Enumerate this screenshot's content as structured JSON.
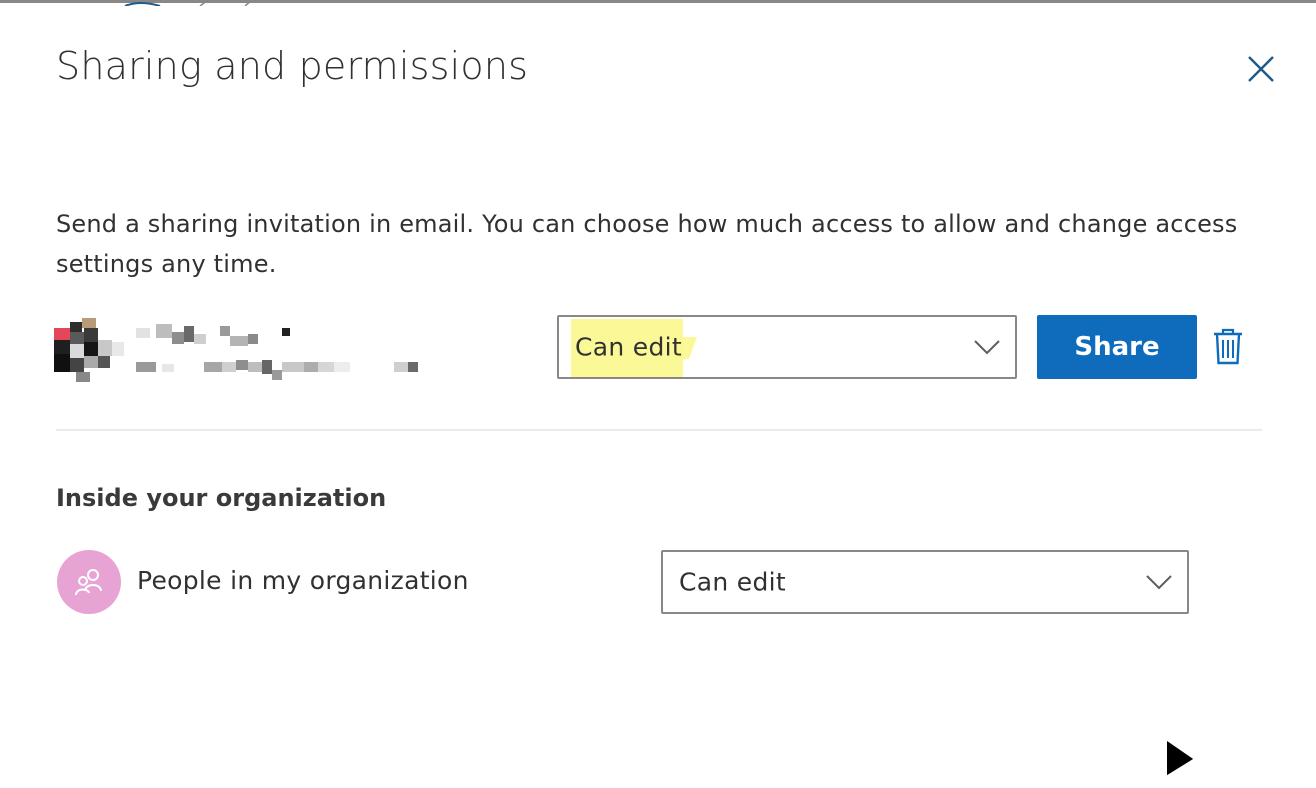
{
  "dialog": {
    "title": "Sharing and permissions"
  },
  "icons": {
    "close": "close-icon",
    "chevron": "chevron-down-icon",
    "trash": "trash-icon",
    "people": "people-icon",
    "cursor": "cursor-arrow-icon"
  },
  "invite": {
    "description": "Send a sharing invitation in email. You can choose how much access to allow and change access settings any time.",
    "permission": "Can edit",
    "share_label": "Share"
  },
  "organization": {
    "section_title": "Inside your organization",
    "label": "People in my organization",
    "permission": "Can edit"
  },
  "colors": {
    "accent": "#0f6cbd",
    "highlight": "#fbf88c",
    "org_avatar": "#e8a3d5",
    "border": "#8a8886",
    "divider": "#edebe9"
  }
}
